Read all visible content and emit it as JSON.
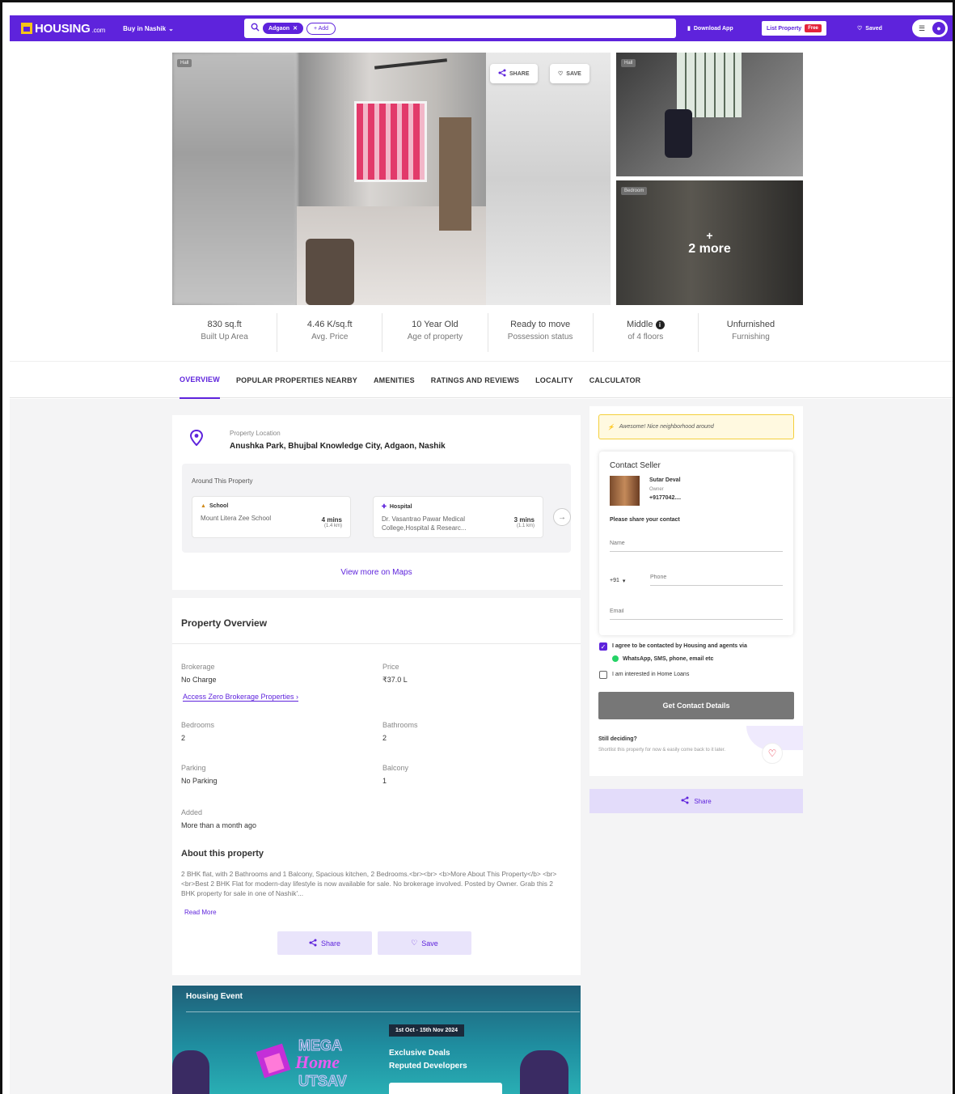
{
  "header": {
    "logo_text": "HOUSING",
    "logo_suffix": ".com",
    "city_select": "Buy in Nashik",
    "search_chip": "Adgaon",
    "search_add": "+ Add",
    "download_app": "Download App",
    "list_property": "List Property",
    "free_tag": "Free",
    "saved": "Saved",
    "accent": "#5e23dc"
  },
  "gallery": {
    "main_label": "Hall",
    "share_label": "SHARE",
    "save_label": "SAVE",
    "side1_label": "Hall",
    "side2_label": "Bedroom",
    "more_label": "2 more"
  },
  "stats": [
    {
      "value": "830 sq.ft",
      "label": "Built Up Area"
    },
    {
      "value": "4.46 K/sq.ft",
      "label": "Avg. Price"
    },
    {
      "value": "10 Year Old",
      "label": "Age of property"
    },
    {
      "value": "Ready to move",
      "label": "Possession status"
    },
    {
      "value": "Middle",
      "label": "of 4 floors"
    },
    {
      "value": "Unfurnished",
      "label": "Furnishing"
    }
  ],
  "tabs": [
    "OVERVIEW",
    "POPULAR PROPERTIES NEARBY",
    "AMENITIES",
    "RATINGS AND REVIEWS",
    "LOCALITY",
    "CALCULATOR"
  ],
  "location": {
    "kicker": "Property Location",
    "address": "Anushka Park, Bhujbal Knowledge City, Adgaon, Nashik",
    "around_title": "Around This Property",
    "poi": [
      {
        "category": "School",
        "name": "Mount Litera Zee School",
        "time": "4 mins",
        "dist": "(1.4 km)"
      },
      {
        "category": "Hospital",
        "name": "Dr. Vasantrao Pawar Medical College,Hospital & Researc...",
        "time": "3 mins",
        "dist": "(1.1 km)"
      }
    ],
    "maps_link": "View more on Maps"
  },
  "overview": {
    "title": "Property Overview",
    "brokerage_k": "Brokerage",
    "brokerage_v": "No Charge",
    "zero_link": "Access Zero Brokerage Properties ›",
    "price_k": "Price",
    "price_v": "₹37.0 L",
    "bedrooms_k": "Bedrooms",
    "bedrooms_v": "2",
    "bathrooms_k": "Bathrooms",
    "bathrooms_v": "2",
    "parking_k": "Parking",
    "parking_v": "No Parking",
    "balcony_k": "Balcony",
    "balcony_v": "1",
    "added_k": "Added",
    "added_v": "More than a month ago",
    "about_title": "About this property",
    "about_text": "2 BHK flat, with 2 Bathrooms and 1 Balcony, Spacious kitchen, 2 Bedrooms.<br><br> <b>More About This Property</b> <br><br>Best 2 BHK Flat for modern-day lifestyle is now available for sale. No brokerage involved. Posted by Owner. Grab this 2 BHK property for sale in one of Nashik'...",
    "read_more": "Read More",
    "share_btn": "Share",
    "save_btn": "Save"
  },
  "event": {
    "title": "Housing Event",
    "dates": "1st Oct - 15th Nov 2024",
    "line1": "Exclusive Deals",
    "line2": "Reputed Developers",
    "logo_word1": "MEGA",
    "logo_word2": "Home",
    "logo_word3": "UTSAV"
  },
  "contact": {
    "hint": "Awesome! Nice neighborhood around",
    "title": "Contact Seller",
    "seller_name": "Sutar Deval",
    "seller_role": "Owner",
    "seller_phone": "+9177042....",
    "share_label": "Please share your contact",
    "name_ph": "Name",
    "cc": "+91",
    "phone_ph": "Phone",
    "email_ph": "Email",
    "agree_line1": "I agree to be contacted by Housing and agents via",
    "agree_line2": "WhatsApp, SMS, phone, email etc",
    "home_loan": "I am interested in Home Loans",
    "get_btn": "Get Contact Details",
    "still": "Still deciding?",
    "still_sub": "Shortlist this property for now & easily come back to it later.",
    "share_wide": "Share"
  }
}
